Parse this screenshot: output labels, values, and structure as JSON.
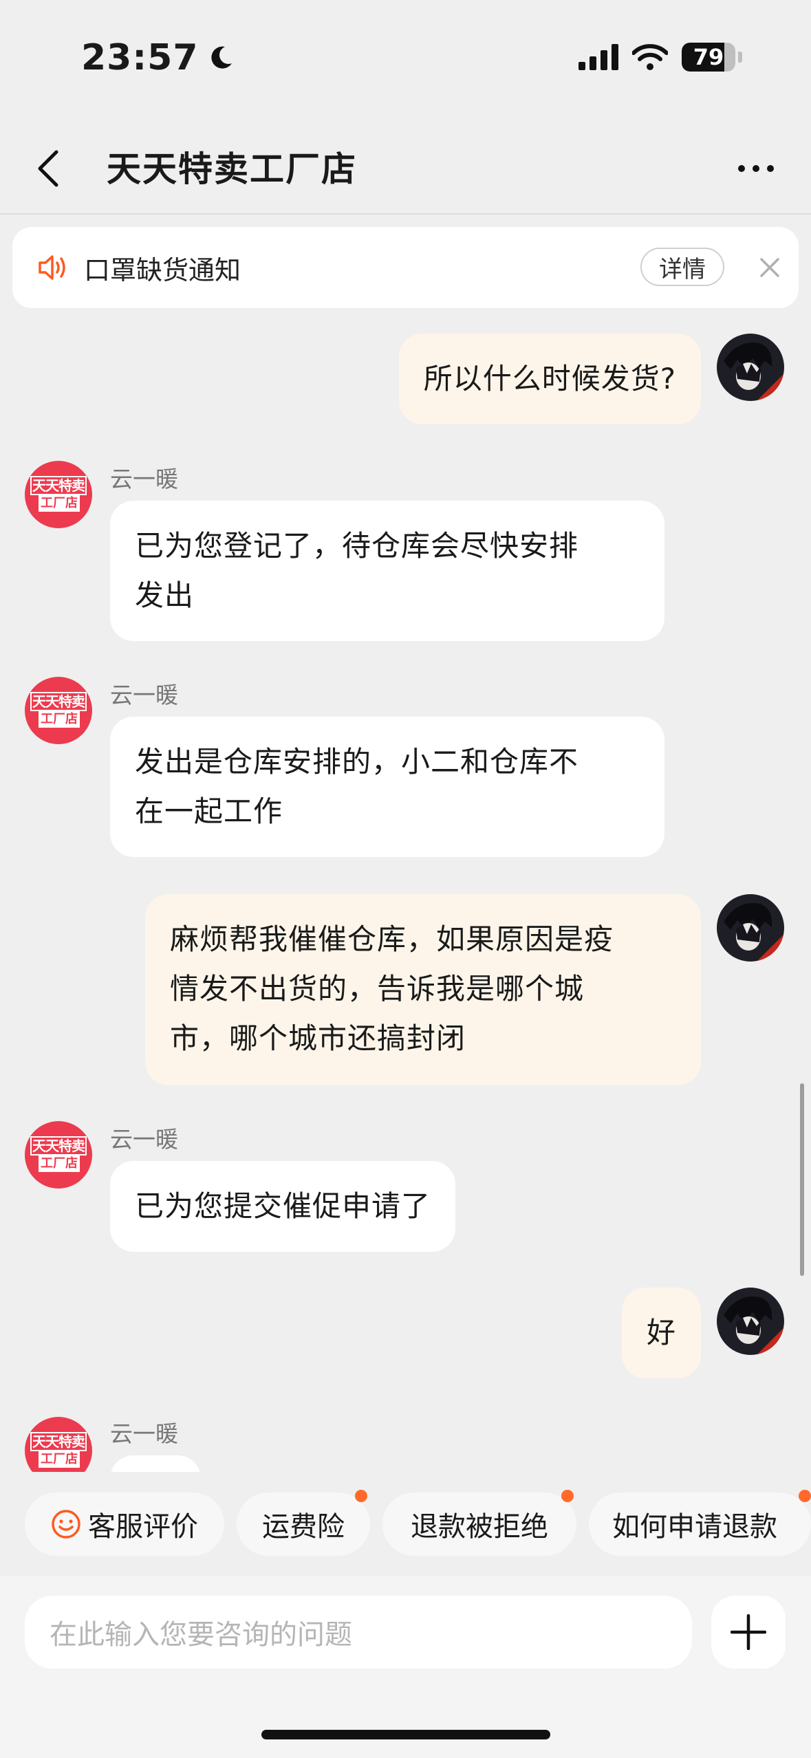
{
  "status_bar": {
    "time": "23:57",
    "battery": "79",
    "battery_level": 0.79,
    "icons": [
      "moon-icon",
      "cellular-signal-icon",
      "wifi-icon",
      "battery-icon"
    ]
  },
  "header": {
    "title": "天天特卖工厂店",
    "icons": [
      "back-arrow-icon",
      "more-dots-icon"
    ]
  },
  "notice": {
    "text": "口罩缺货通知",
    "detail_label": "详情",
    "icons": [
      "speaker-icon",
      "close-icon"
    ],
    "accent_color": "#ff5a1f"
  },
  "shop_avatar": {
    "line1": "天天特卖",
    "line2": "工厂店"
  },
  "messages": [
    {
      "from": "user",
      "text": "所以什么时候发货?"
    },
    {
      "from": "agent",
      "sender": "云一暖",
      "lines": [
        "已为您登记了，待仓库会尽快安排",
        "发出"
      ]
    },
    {
      "from": "agent",
      "sender": "云一暖",
      "lines": [
        "发出是仓库安排的，小二和仓库不",
        "在一起工作"
      ]
    },
    {
      "from": "user",
      "lines": [
        "麻烦帮我催催仓库，如果原因是疫",
        "情发不出货的，告诉我是哪个城",
        "市，哪个城市还搞封闭"
      ]
    },
    {
      "from": "agent",
      "sender": "云一暖",
      "text": "已为您提交催促申请了"
    },
    {
      "from": "user",
      "text": "好"
    },
    {
      "from": "agent",
      "sender": "云一暖",
      "text": ""
    }
  ],
  "quick_replies": [
    {
      "label": "客服评价",
      "icon": "smile-icon",
      "dot": false
    },
    {
      "label": "运费险",
      "dot": true
    },
    {
      "label": "退款被拒绝",
      "dot": true
    },
    {
      "label": "如何申请退款",
      "dot": true
    }
  ],
  "input": {
    "placeholder": "在此输入您要咨询的问题",
    "icons": [
      "plus-icon"
    ]
  },
  "colors": {
    "user_bubble": "#fdf5ea",
    "agent_bubble": "#ffffff",
    "background": "#efefef",
    "badge_dot": "#ff6a2b",
    "shop_logo": "#ec3b4f"
  }
}
